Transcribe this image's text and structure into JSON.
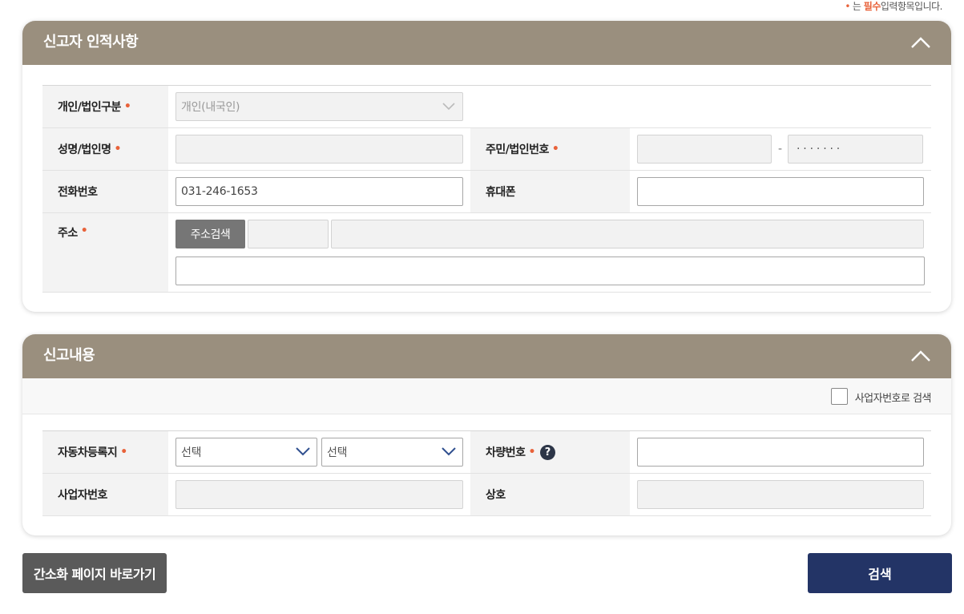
{
  "required_note": {
    "bullet": "•",
    "prefix": "는",
    "highlight": "필수",
    "suffix": "입력항목입니다."
  },
  "reporter_section": {
    "title": "신고자 인적사항",
    "collapse_icon": "chevron-up-icon",
    "type_label": "개인/법인구분",
    "type_value": "개인(내국인)",
    "name_label": "성명/법인명",
    "name_value": "",
    "idnum_label": "주민/법인번호",
    "idnum_front": "",
    "idnum_dash": "-",
    "idnum_back_mask": "· · · · · · ·",
    "phone_label": "전화번호",
    "phone_value": "031-246-1653",
    "mobile_label": "휴대폰",
    "mobile_value": "",
    "address_label": "주소",
    "address_search_button": "주소검색",
    "zipcode_value": "",
    "address_value": "",
    "address_detail_value": "",
    "required_mark": "•"
  },
  "report_section": {
    "title": "신고내용",
    "collapse_icon": "chevron-up-icon",
    "bizno_search_checkbox_label": "사업자번호로 검색",
    "bizno_search_checked": false,
    "registration_label": "자동차등록지",
    "registration_select1": "선택",
    "registration_select2": "선택",
    "plate_label": "차량번호",
    "plate_help_icon": "question-icon",
    "plate_help_glyph": "?",
    "plate_value": "",
    "bizno_label": "사업자번호",
    "bizno_value": "",
    "company_label": "상호",
    "company_value": "",
    "required_mark": "•"
  },
  "buttons": {
    "simple_page": "간소화 페이지 바로가기",
    "search": "검색"
  },
  "colors": {
    "header_bg": "#9a8f7e",
    "required": "#e8623a",
    "search_button": "#233466",
    "simple_button": "#5a5a5a",
    "address_button": "#767676"
  }
}
